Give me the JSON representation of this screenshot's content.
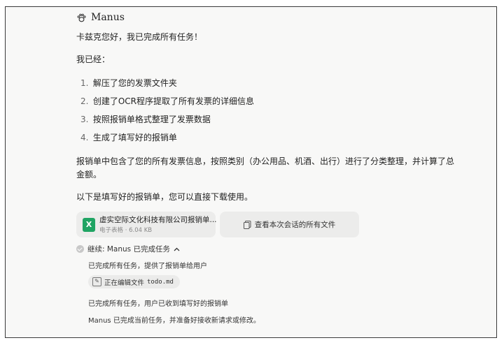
{
  "header": {
    "brand": "Manus",
    "brand_icon": "manus-paw-icon"
  },
  "message": {
    "greeting": "卡兹克您好，我已完成所有任务！",
    "intro": "我已经：",
    "steps": [
      {
        "num": "1.",
        "text": "解压了您的发票文件夹"
      },
      {
        "num": "2.",
        "text": "创建了OCR程序提取了所有发票的详细信息"
      },
      {
        "num": "3.",
        "text": "按照报销单格式整理了发票数据"
      },
      {
        "num": "4.",
        "text": "生成了填写好的报销单"
      }
    ],
    "summary_line1": "报销单中包含了您的所有发票信息，按照类别（办公用品、机酒、出行）进行了分类整理，并计算了总",
    "summary_line2": "金额。",
    "download_note": "以下是填写好的报销单，您可以直接下载使用。"
  },
  "attachment": {
    "name": "虚实空际文化科技有限公司报销单...",
    "meta": "电子表格 · 6.04 KB",
    "icon_letter": "X",
    "icon_color": "#1fa463"
  },
  "all_files_button": {
    "label": "查看本次会话的所有文件"
  },
  "status": {
    "label": "继续:  Manus 已完成任务",
    "line1": "已完成所有任务，提供了报销单给用户",
    "pill_prefix": "正在编辑文件",
    "pill_file": "todo.md",
    "line2": "已完成所有任务，用户已收到填写好的报销单",
    "line3": "Manus 已完成当前任务，并准备好接收新请求或修改。"
  }
}
